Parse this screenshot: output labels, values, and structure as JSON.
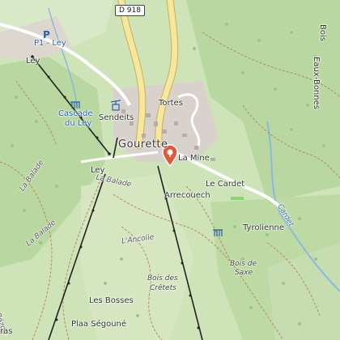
{
  "colors": {
    "forest": "#b9d7a0",
    "meadow": "#d9e9c8",
    "urban": "#d8d1cc",
    "road_main": "#f5e6a0",
    "road_casing": "#c9b24a",
    "path": "#b58a5a",
    "lift": "#222222",
    "water": "#8cb8e0",
    "marker": "#e2573a"
  },
  "labels": {
    "road_shield": "D 918",
    "parking": "P1 - Ley",
    "ley_top": "Ley",
    "cascade": "Cascade",
    "cascade2": "du Ley",
    "sendeits": "Sendeits",
    "tortes": "Tortes",
    "gourette": "Gourette",
    "la_mine": "La Mine",
    "ley_mid": "Ley",
    "la_balade": "La Balade",
    "la_balade2": "La Balade",
    "la_balade3": "La Balade",
    "arrecouech": "Arrecouech",
    "le_cardet": "Le Cardet",
    "cardet_stream": "Cardet",
    "tyrolienne": "Tyrolienne",
    "lancolie": "L'Ancolie",
    "bois_de_saxe": "Bois de",
    "bois_de_saxe2": "Saxe",
    "bois_des_cretets": "Bois des",
    "bois_des_cretets2": "Crêtets",
    "les_bosses": "Les Bosses",
    "plaa_segoune": "Plaa Ségouné",
    "eaux_bonnes": "Eaux-Bonnes",
    "bois": "Bois",
    "bezou": "Bézou",
    "ras": "ras"
  },
  "icons": {
    "parking": "parking-icon",
    "marker": "location-pin-icon",
    "waterfall": "waterfall-icon",
    "aerial": "aerial-tramway-icon"
  }
}
